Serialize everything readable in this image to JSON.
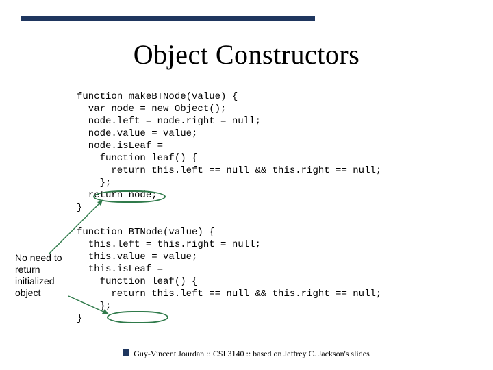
{
  "slide": {
    "title": "Object Constructors",
    "code": "function makeBTNode(value) {\n  var node = new Object();\n  node.left = node.right = null;\n  node.value = value;\n  node.isLeaf =\n    function leaf() {\n      return this.left == null && this.right == null;\n    };\n  return node;\n}\n\nfunction BTNode(value) {\n  this.left = this.right = null;\n  this.value = value;\n  this.isLeaf =\n    function leaf() {\n      return this.left == null && this.right == null;\n    };\n}",
    "annotation": "No need to return initialized object",
    "footer": "Guy-Vincent Jourdan :: CSI 3140 :: based on Jeffrey C. Jackson's slides"
  }
}
